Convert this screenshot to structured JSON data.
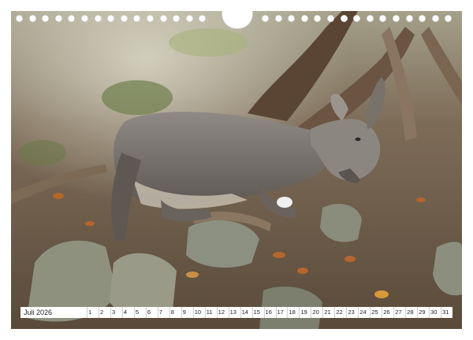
{
  "calendar": {
    "month_label": "Juli 2026",
    "days": [
      "1",
      "2",
      "3",
      "4",
      "5",
      "6",
      "7",
      "8",
      "9",
      "10",
      "11",
      "12",
      "13",
      "14",
      "15",
      "16",
      "17",
      "18",
      "19",
      "20",
      "21",
      "22",
      "23",
      "24",
      "25",
      "26",
      "27",
      "28",
      "29",
      "30",
      "31"
    ]
  },
  "photo": {
    "subject": "resting-ibex"
  }
}
